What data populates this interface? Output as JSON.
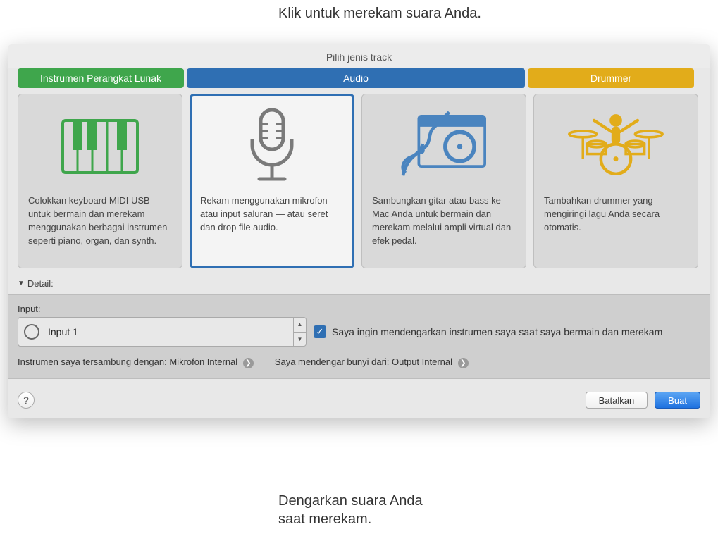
{
  "callouts": {
    "top": "Klik untuk merekam suara Anda.",
    "bottom": "Dengarkan suara Anda\nsaat merekam."
  },
  "dialog": {
    "title": "Pilih jenis track",
    "tabs": {
      "software": "Instrumen Perangkat Lunak",
      "audio": "Audio",
      "drummer": "Drummer"
    },
    "cards": {
      "software": "Colokkan keyboard MIDI USB untuk bermain dan merekam menggunakan berbagai instrumen seperti piano, organ, dan synth.",
      "mic": "Rekam menggunakan mikrofon atau input saluran — atau seret dan drop file audio.",
      "guitar": "Sambungkan gitar atau bass ke Mac Anda untuk bermain dan merekam melalui ampli virtual dan efek pedal.",
      "drummer": "Tambahkan drummer yang mengiringi lagu Anda secara otomatis."
    },
    "detail_label": "Detail:",
    "input_label": "Input:",
    "input_value": "Input 1",
    "monitor_checkbox": "Saya ingin mendengarkan instrumen saya saat saya bermain dan merekam",
    "status": {
      "connected": "Instrumen saya tersambung dengan: Mikrofon Internal",
      "output": "Saya mendengar bunyi dari: Output Internal"
    },
    "buttons": {
      "help": "?",
      "cancel": "Batalkan",
      "create": "Buat"
    }
  }
}
